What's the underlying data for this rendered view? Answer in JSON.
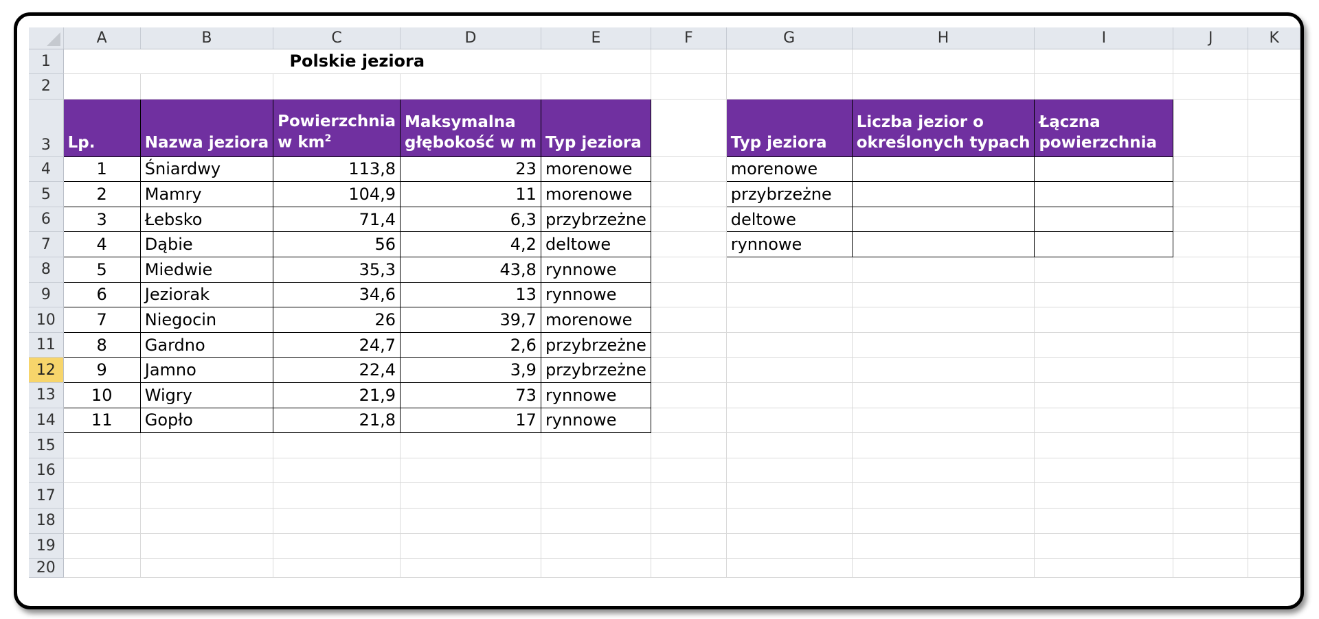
{
  "columns": [
    "A",
    "B",
    "C",
    "D",
    "E",
    "F",
    "G",
    "H",
    "I",
    "J",
    "K"
  ],
  "row_numbers": [
    "1",
    "2",
    "3",
    "4",
    "5",
    "6",
    "7",
    "8",
    "9",
    "10",
    "11",
    "12",
    "13",
    "14",
    "15",
    "16",
    "17",
    "18",
    "19",
    "20"
  ],
  "active_row": "12",
  "title": "Polskie jeziora",
  "main_table": {
    "headers": {
      "lp": "Lp.",
      "name": "Nazwa jeziora",
      "area_line1": "Powierzchnia",
      "area_line2": "w km",
      "area_sup": "2",
      "depth_line1": "Maksymalna",
      "depth_line2": "głębokość w m",
      "type": "Typ jeziora"
    },
    "rows": [
      {
        "lp": "1",
        "name": "Śniardwy",
        "area": "113,8",
        "depth": "23",
        "type": "morenowe"
      },
      {
        "lp": "2",
        "name": "Mamry",
        "area": "104,9",
        "depth": "11",
        "type": "morenowe"
      },
      {
        "lp": "3",
        "name": "Łebsko",
        "area": "71,4",
        "depth": "6,3",
        "type": "przybrzeżne"
      },
      {
        "lp": "4",
        "name": "Dąbie",
        "area": "56",
        "depth": "4,2",
        "type": "deltowe"
      },
      {
        "lp": "5",
        "name": "Miedwie",
        "area": "35,3",
        "depth": "43,8",
        "type": "rynnowe"
      },
      {
        "lp": "6",
        "name": "Jeziorak",
        "area": "34,6",
        "depth": "13",
        "type": "rynnowe"
      },
      {
        "lp": "7",
        "name": "Niegocin",
        "area": "26",
        "depth": "39,7",
        "type": "morenowe"
      },
      {
        "lp": "8",
        "name": "Gardno",
        "area": "24,7",
        "depth": "2,6",
        "type": "przybrzeżne"
      },
      {
        "lp": "9",
        "name": "Jamno",
        "area": "22,4",
        "depth": "3,9",
        "type": "przybrzeżne"
      },
      {
        "lp": "10",
        "name": "Wigry",
        "area": "21,9",
        "depth": "73",
        "type": "rynnowe"
      },
      {
        "lp": "11",
        "name": "Gopło",
        "area": "21,8",
        "depth": "17",
        "type": "rynnowe"
      }
    ]
  },
  "summary_table": {
    "headers": {
      "type": "Typ jeziora",
      "count_line1": "Liczba jezior o",
      "count_line2": "określonych typach",
      "total_line1": "Łączna",
      "total_line2": "powierzchnia"
    },
    "rows": [
      {
        "type": "morenowe",
        "count": "",
        "total": ""
      },
      {
        "type": "przybrzeżne",
        "count": "",
        "total": ""
      },
      {
        "type": "deltowe",
        "count": "",
        "total": ""
      },
      {
        "type": "rynnowe",
        "count": "",
        "total": ""
      }
    ]
  },
  "colors": {
    "header_fill": "#7030a0",
    "header_text": "#ffffff",
    "active_row_header": "#f7d56b"
  }
}
